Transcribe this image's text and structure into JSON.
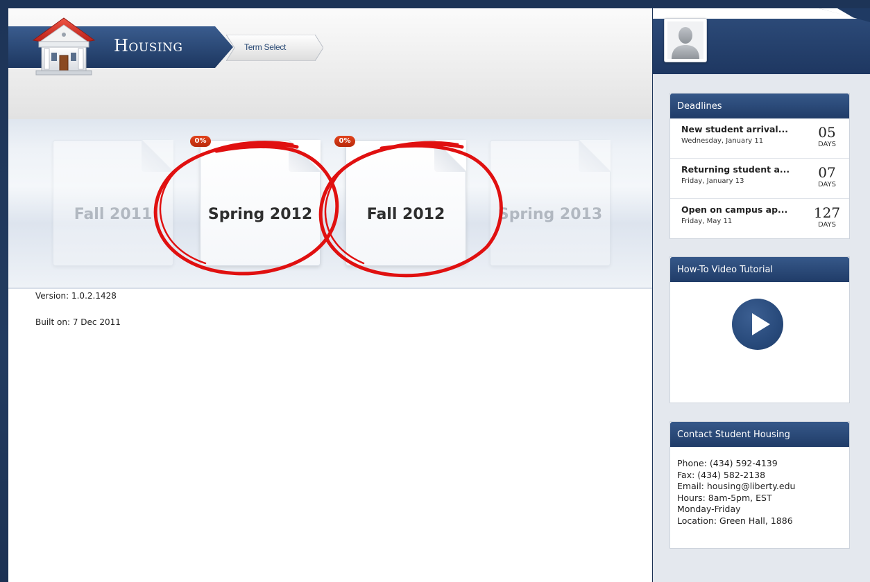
{
  "breadcrumb": {
    "home_label": "Housing",
    "current_label": "Term Select"
  },
  "terms": [
    {
      "label": "Fall 2011",
      "state": "inactive"
    },
    {
      "label": "Spring 2012",
      "state": "active",
      "badge": "0%"
    },
    {
      "label": "Fall 2012",
      "state": "active",
      "badge": "0%"
    },
    {
      "label": "Spring 2013",
      "state": "inactive"
    }
  ],
  "build_info": {
    "version": "Version: 1.0.2.1428",
    "built_on": "Built on: 7 Dec 2011"
  },
  "deadlines": {
    "title": "Deadlines",
    "items": [
      {
        "title": "New student arrival...",
        "date": "Wednesday, January 11",
        "count": "05",
        "unit": "DAYS"
      },
      {
        "title": "Returning student a...",
        "date": "Friday, January 13",
        "count": "07",
        "unit": "DAYS"
      },
      {
        "title": "Open on campus ap...",
        "date": "Friday, May 11",
        "count": "127",
        "unit": "DAYS"
      }
    ]
  },
  "video": {
    "title": "How-To Video Tutorial"
  },
  "contact": {
    "title": "Contact Student Housing",
    "lines": [
      "Phone: (434) 592-4139",
      "Fax: (434) 582-2138",
      "Email: housing@liberty.edu",
      "Hours: 8am-5pm, EST",
      "Monday-Friday",
      "Location: Green Hall, 1886"
    ]
  },
  "colors": {
    "brand_navy": "#233f6a",
    "badge_red": "#d23a17",
    "annotation_red": "#e01010"
  },
  "icons": {
    "logo": "house-building-icon",
    "avatar": "user-silhouette-icon",
    "video": "play-icon"
  }
}
